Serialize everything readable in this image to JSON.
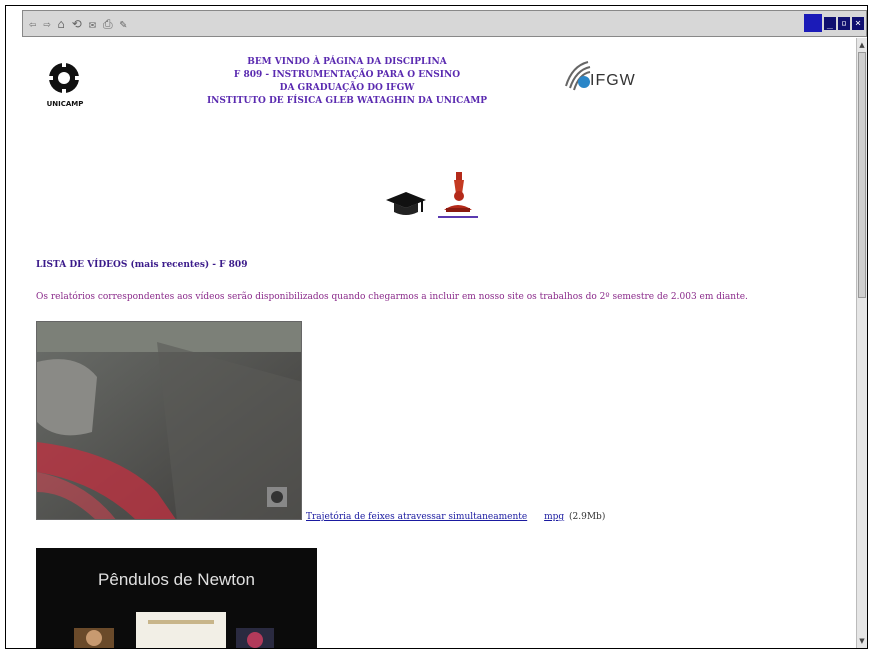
{
  "toolbar": {
    "buttons": [
      "⇦",
      "⇨",
      "⌂",
      "⟲",
      "✉",
      "⎙",
      "✎"
    ],
    "window_controls": [
      "_",
      "▫",
      "×"
    ]
  },
  "header": {
    "line1": "BEM VINDO À PÁGINA DA DISCIPLINA",
    "line2": "F 809 - INSTRUMENTAÇÃO PARA O ENSINO",
    "line3": "DA GRADUAÇÃO DO IFGW",
    "line4": "INSTITUTO DE FÍSICA GLEB WATAGHIN DA UNICAMP",
    "unicamp_label": "UNICAMP",
    "ifgw_label": "IFGW"
  },
  "list": {
    "title": "LISTA DE VÍDEOS (mais recentes) - F 809",
    "notice": "Os relatórios correspondentes aos vídeos serão disponibilizados quando chegarmos a incluir em nosso site os trabalhos do 2º semestre de 2.003 em diante."
  },
  "videos": [
    {
      "link": "Trajetória de feixes atravessar simultaneamente",
      "format": "mpg",
      "size": "(2.9Mb)"
    }
  ],
  "newton": {
    "title": "Pêndulos de Newton"
  },
  "colors": {
    "header_purple": "#5a2ab0",
    "link_blue": "#1a1aa0",
    "notice_purple": "#8a2a8a"
  }
}
